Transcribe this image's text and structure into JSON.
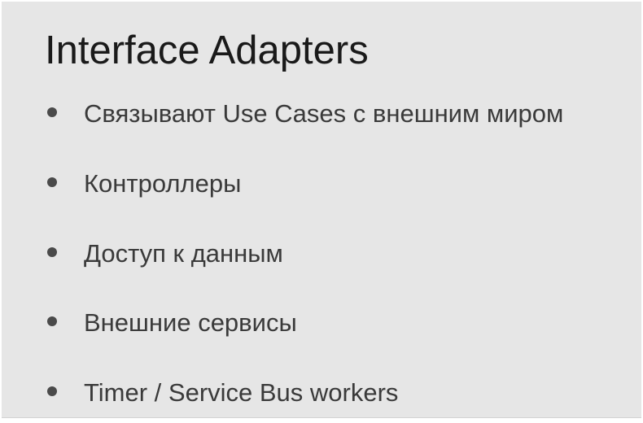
{
  "slide": {
    "title": "Interface Adapters",
    "bullets": [
      "Связывают Use Cases с внешним миром",
      "Контроллеры",
      "Доступ к данным",
      "Внешние сервисы",
      "Timer / Service Bus workers"
    ]
  },
  "colors": {
    "background": "#e6e6e6",
    "title_text": "#1a1a1a",
    "body_text": "#3a3a3a",
    "bullet": "#4a4a4a"
  }
}
